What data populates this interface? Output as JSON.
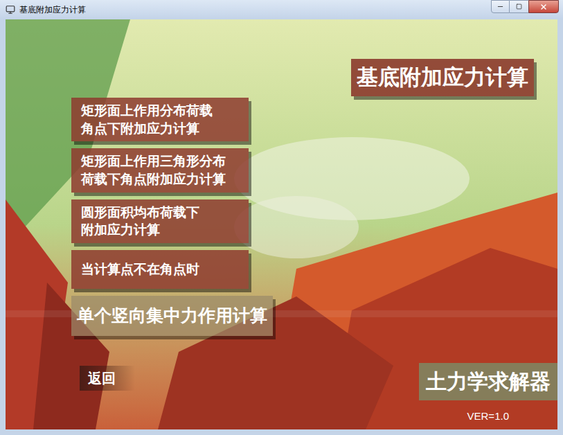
{
  "window": {
    "title": "基底附加应力计算"
  },
  "heading": "基底附加应力计算",
  "menu": [
    {
      "lines": [
        "矩形面上作用分布荷载",
        "角点下附加应力计算"
      ],
      "highlighted": false
    },
    {
      "lines": [
        "矩形面上作用三角形分布",
        "荷载下角点附加应力计算"
      ],
      "highlighted": false
    },
    {
      "lines": [
        "圆形面积均布荷载下",
        "附加应力计算"
      ],
      "highlighted": false
    },
    {
      "lines": [
        "当计算点不在角点时"
      ],
      "highlighted": false
    },
    {
      "lines": [
        "单个竖向集中力作用计算"
      ],
      "highlighted": true
    }
  ],
  "back_button": "返回",
  "brand": "土力学求解器",
  "version": "VER=1.0"
}
